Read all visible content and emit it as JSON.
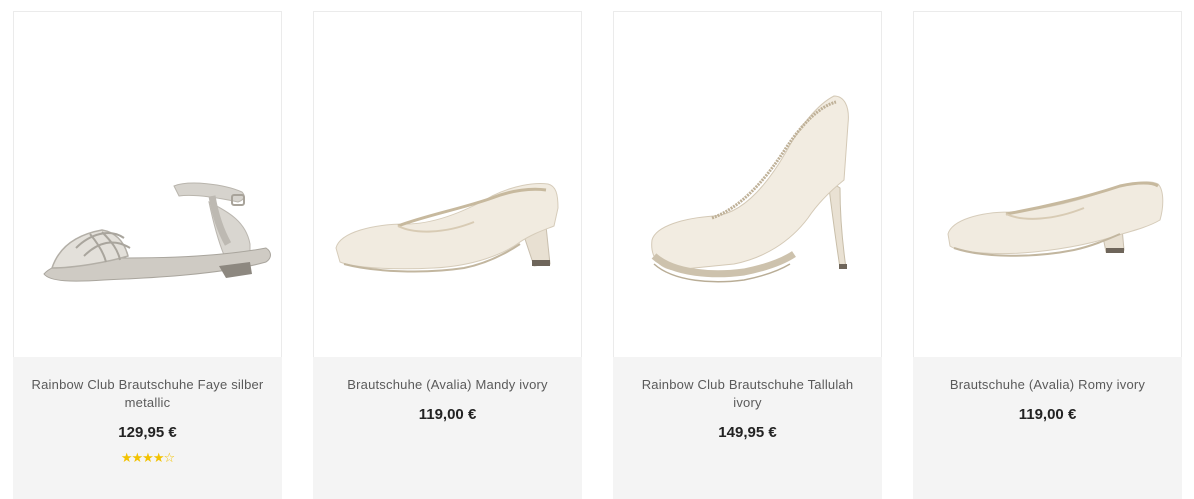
{
  "products": [
    {
      "name": "Rainbow Club Brautschuhe Faye silber metallic",
      "price": "129,95 €",
      "rating": 4,
      "rating_max": 5,
      "image_icon": "silver-flat-sandal"
    },
    {
      "name": "Brautschuhe (Avalia) Mandy ivory",
      "price": "119,00 €",
      "image_icon": "ivory-block-heel-pump"
    },
    {
      "name": "Rainbow Club Brautschuhe Tallulah ivory",
      "price": "149,95 €",
      "image_icon": "ivory-stiletto-platform-pump"
    },
    {
      "name": "Brautschuhe (Avalia) Romy ivory",
      "price": "119,00 €",
      "image_icon": "ivory-low-heel-pump"
    }
  ],
  "colors": {
    "info_background": "#f4f4f4",
    "star": "#f2c200",
    "ivory": "#efe7da",
    "silver": "#c9c6c0"
  }
}
